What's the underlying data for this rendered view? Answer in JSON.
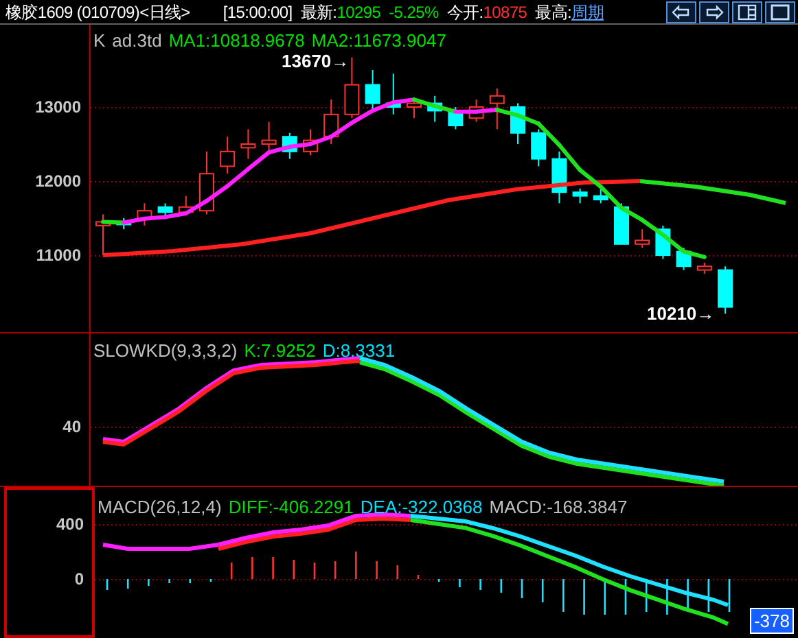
{
  "header": {
    "symbol": "橡胶1609 (010709)<日线>",
    "time": "[15:00:00]",
    "last_label": "最新:",
    "last_value": "10295",
    "change": "-5.25%",
    "open_label": "今开:",
    "open_value": "10875",
    "high_label": "最高:",
    "period_link": "周期"
  },
  "main_panel": {
    "legend": [
      {
        "text": "K",
        "color": "#c0c0c0"
      },
      {
        "text": "ad.3td",
        "color": "#c0c0c0"
      },
      {
        "text": "MA1:10818.9678",
        "color": "#00e000"
      },
      {
        "text": "MA2:11673.9047",
        "color": "#00e000"
      }
    ],
    "y_labels": [
      "13000",
      "12000",
      "11000"
    ],
    "high_marker": "13670→",
    "low_marker": "10210→"
  },
  "kd_panel": {
    "legend": [
      {
        "text": "SLOWKD(9,3,3,2)",
        "color": "#c0c0c0"
      },
      {
        "text": "K:7.9252",
        "color": "#00e000"
      },
      {
        "text": "D:8.3331",
        "color": "#00e0ff"
      }
    ],
    "y_labels": [
      "40"
    ]
  },
  "macd_panel": {
    "legend": [
      {
        "text": "MACD(26,12,4)",
        "color": "#c0c0c0"
      },
      {
        "text": "DIFF:-406.2291",
        "color": "#00e000"
      },
      {
        "text": "DEA:-322.0368",
        "color": "#00e0ff"
      },
      {
        "text": "MACD:-168.3847",
        "color": "#c0c0c0"
      }
    ],
    "y_labels": [
      "400",
      "0"
    ],
    "last_badge": "-378"
  }
}
